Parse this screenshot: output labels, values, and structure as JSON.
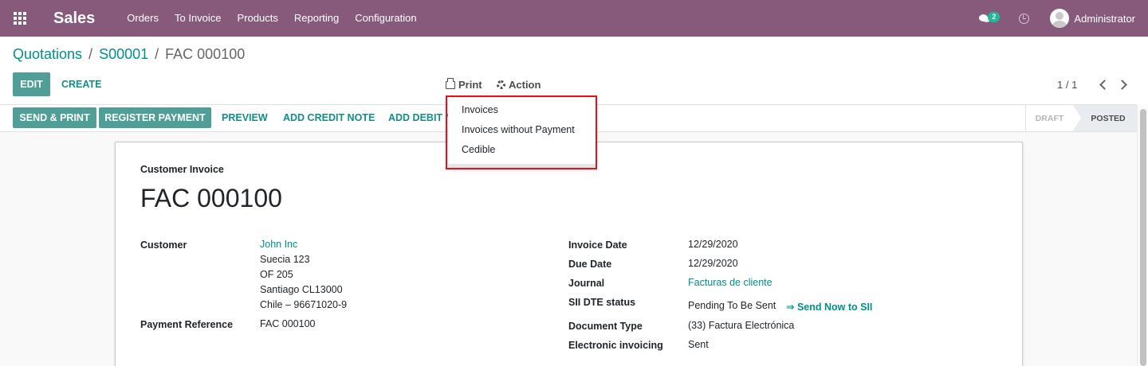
{
  "navbar": {
    "app_name": "Sales",
    "menu": [
      "Orders",
      "To Invoice",
      "Products",
      "Reporting",
      "Configuration"
    ],
    "messages_badge": "2",
    "user_name": "Administrator"
  },
  "breadcrumb": {
    "items": [
      "Quotations",
      "S00001"
    ],
    "current": "FAC 000100",
    "separator": "/"
  },
  "control": {
    "edit_label": "EDIT",
    "create_label": "CREATE",
    "print_label": "Print",
    "action_label": "Action",
    "pager": "1 / 1"
  },
  "print_menu": {
    "items": [
      "Invoices",
      "Invoices without Payment",
      "Cedible"
    ]
  },
  "statusbar": {
    "buttons": [
      "SEND & PRINT",
      "REGISTER PAYMENT",
      "PREVIEW",
      "ADD CREDIT NOTE",
      "ADD DEBIT N"
    ],
    "stages": [
      "DRAFT",
      "POSTED"
    ],
    "active_stage": "POSTED"
  },
  "invoice": {
    "type_label": "Customer Invoice",
    "number": "FAC 000100",
    "customer_label": "Customer",
    "customer_name": "John Inc",
    "customer_address": [
      "Suecia 123",
      "OF 205",
      "Santiago CL13000",
      "Chile – 96671020-9"
    ],
    "payment_ref_label": "Payment Reference",
    "payment_ref": "FAC 000100",
    "invoice_date_label": "Invoice Date",
    "invoice_date": "12/29/2020",
    "due_date_label": "Due Date",
    "due_date": "12/29/2020",
    "journal_label": "Journal",
    "journal": "Facturas de cliente",
    "sii_label": "SII DTE status",
    "sii_status": "Pending To Be Sent",
    "send_sii_label": "⇒ Send Now to SII",
    "doc_type_label": "Document Type",
    "doc_type": "(33) Factura Electrónica",
    "einvoicing_label": "Electronic invoicing",
    "einvoicing": "Sent"
  },
  "colors": {
    "navbar": "#875a7b",
    "primary": "#00a09d",
    "highlight": "#e8101c"
  }
}
